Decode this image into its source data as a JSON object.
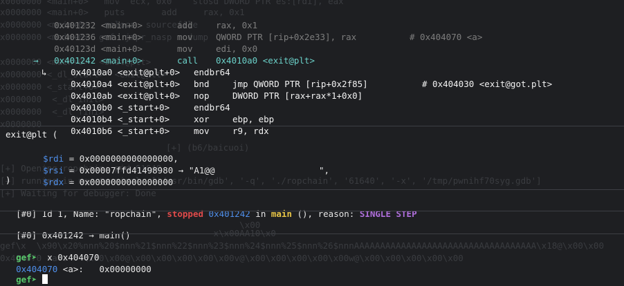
{
  "background_ghost": [
    "x0000000 <main+0>   mov  ecx, 0x0    stosd DWORD PTR es:[rdi], eax",
    "x0000000 <main+0>   puts       add     rax, 0x1",
    "x0000000 <main+0>   relocs  sourcefile",
    "x0000000 <main+0>  gef  jmpr_nasp   dump",
    "x0000000 <main+0>  <exit@plt>",
    "x0000000 <_dl_start>  <exit@plt>",
    "x0000000 <_start+0>",
    "x0000000  <_dl_init>",
    "x0000000  <_dl_fini>",
    "x0000000",
    "[+] (b6/baicuoi)",
    "[+] Opening ropchain: pid 61640",
    "[+] running in new terminal: ['/usr/bin/gdb', '-q', './ropchain', '61640', '-x', '/tmp/pwnihf70syg.gdb']",
    "[+] Waiting for debugger: Done",
    "                                              \\x00",
    "                                         x\\x00AA10\\x0",
    "gef\\x  \\x90\\x20%nnn%20$nnn%21$nnn%22$nnn%23$nnn%24$nnn%25$nnn%26$nnnAAAAAAAAAAAAAAAAAAAAAAAAAAAAAAAAAAA\\x18@\\x00\\x00",
    "0x404070 <a>:   \\x00\\x00@\\x00\\x00\\x00\\x00\\x00v@\\x00\\x00\\x00\\x00\\x00w@\\x00\\x00\\x00\\x00\\x00"
  ],
  "disasm": [
    {
      "marker": "",
      "addr": "0x401232",
      "sym": "<main+0>",
      "mnem": "add",
      "ops": "rax, 0x1",
      "comment": ""
    },
    {
      "marker": "",
      "addr": "0x401236",
      "sym": "<main+0>",
      "mnem": "mov",
      "ops": "QWORD PTR [rip+0x2e33], rax",
      "comment": "# 0x404070 <a>"
    },
    {
      "marker": "",
      "addr": "0x40123d",
      "sym": "<main+0>",
      "mnem": "mov",
      "ops": "edi, 0x0",
      "comment": ""
    },
    {
      "marker": "→",
      "addr": "0x401242",
      "sym": "<main+0>",
      "mnem": "call",
      "ops": "0x4010a0 <exit@plt>",
      "comment": ""
    }
  ],
  "call_target": [
    {
      "marker": "↳",
      "addr": "0x4010a0",
      "sym": "<exit@plt+0>",
      "mnem": "endbr64",
      "ops": "",
      "comment": ""
    },
    {
      "marker": "",
      "addr": "0x4010a4",
      "sym": "<exit@plt+0>",
      "mnem": "bnd",
      "ops": "jmp QWORD PTR [rip+0x2f85]",
      "comment": "# 0x404030 <exit@got.plt>"
    },
    {
      "marker": "",
      "addr": "0x4010ab",
      "sym": "<exit@plt+0>",
      "mnem": "nop",
      "ops": "DWORD PTR [rax+rax*1+0x0]",
      "comment": ""
    },
    {
      "marker": "",
      "addr": "0x4010b0",
      "sym": "<_start+0>",
      "mnem": "endbr64",
      "ops": "",
      "comment": ""
    },
    {
      "marker": "",
      "addr": "0x4010b4",
      "sym": "<_start+0>",
      "mnem": "xor",
      "ops": "ebp, ebp",
      "comment": ""
    },
    {
      "marker": "",
      "addr": "0x4010b6",
      "sym": "<_start+0>",
      "mnem": "mov",
      "ops": "r9, rdx",
      "comment": ""
    }
  ],
  "args": {
    "header": "exit@plt (",
    "rows": [
      {
        "reg": "$rdi",
        "eq": " = ",
        "val": "0x0000000000000000,",
        "tail": ""
      },
      {
        "reg": "$rsi",
        "eq": " = ",
        "val": "0x00007ffd41498980",
        "tail": " → \"A1@@                    \","
      },
      {
        "reg": "$rdx",
        "eq": " = ",
        "val": "0x0000000000000000",
        "tail": ""
      }
    ],
    "footer": ")"
  },
  "thread": {
    "idx": "[#0]",
    "pre": " Id 1, Name: \"ropchain\", ",
    "state": "stopped",
    "addr": "0x401242",
    "in": " in ",
    "func": "main",
    "post": " (), reason: ",
    "reason": "SINGLE STEP"
  },
  "trace": {
    "idx": "[#0]",
    "text": " 0x401242 → main()"
  },
  "prompt1": {
    "prompt": "gef➤",
    "cmd": "  x 0x404070"
  },
  "mem": {
    "addr": "0x404070",
    "sym": " <a>",
    "rest": ":   0x00000000"
  },
  "prompt2": {
    "prompt": "gef➤"
  },
  "colors": {
    "background": "#1e1f22",
    "pc": "#6bd0c8",
    "stopped": "#e04b4b",
    "func": "#e8c547",
    "reason": "#b06fdc",
    "prompt": "#58c96b",
    "register": "#4f8fea"
  }
}
